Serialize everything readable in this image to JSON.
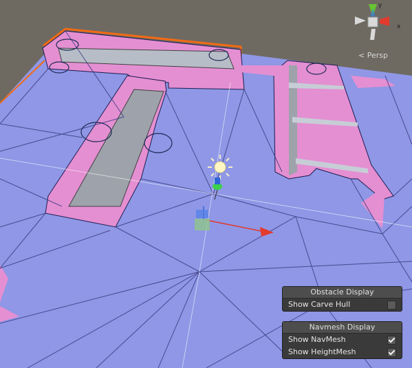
{
  "viewport": {
    "projection_label": "Persp",
    "gizmo": {
      "axis_labels": {
        "y": "y",
        "x": "x"
      },
      "colors": {
        "x": "#e33a2e",
        "y": "#68c531",
        "z": "#2f7bf2",
        "center": "#d9d9d9"
      }
    },
    "scene_colors": {
      "ground": "#8f97e6",
      "carve_hull": "#e48fd2",
      "obstacle_outline": "#f36a13",
      "navmesh_edges": "#3b3b80",
      "grid_lines": "#ffffff",
      "sky": "#6e6a62"
    },
    "icons": [
      "light-icon",
      "player-gizmo-icon",
      "move-handle-icon"
    ]
  },
  "panels": {
    "obstacle": {
      "title": "Obstacle Display",
      "rows": [
        {
          "label": "Show Carve Hull",
          "checked": false
        }
      ]
    },
    "navmesh": {
      "title": "Navmesh Display",
      "rows": [
        {
          "label": "Show NavMesh",
          "checked": true
        },
        {
          "label": "Show HeightMesh",
          "checked": true
        }
      ]
    }
  }
}
